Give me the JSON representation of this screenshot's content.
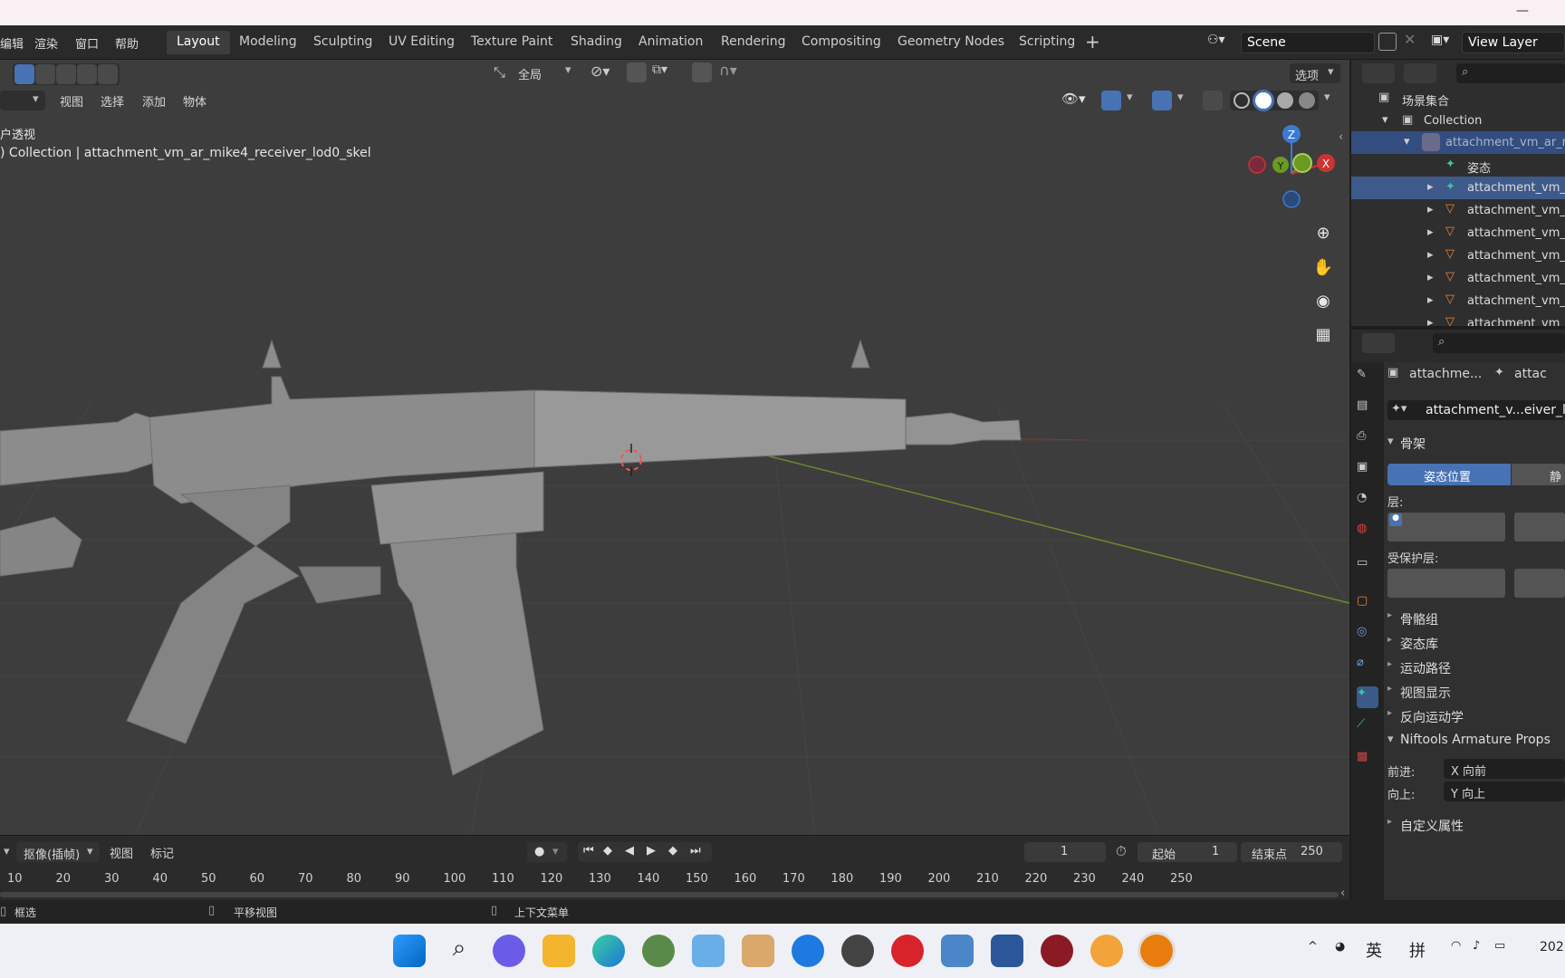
{
  "menu": {
    "edit": "编辑",
    "render": "渲染",
    "window": "窗口",
    "help": "帮助"
  },
  "workspaces": [
    "Layout",
    "Modeling",
    "Sculpting",
    "UV Editing",
    "Texture Paint",
    "Shading",
    "Animation",
    "Rendering",
    "Compositing",
    "Geometry Nodes",
    "Scripting"
  ],
  "active_workspace": "Layout",
  "scene_name": "Scene",
  "view_layer": "View Layer",
  "viewport_header": {
    "transform_orientation": "全局",
    "options": "选项",
    "menus": [
      "视图",
      "选择",
      "添加",
      "物体"
    ]
  },
  "viewport_info": {
    "mode": "户透视",
    "breadcrumb": ") Collection | attachment_vm_ar_mike4_receiver_lod0_skel"
  },
  "gizmo": {
    "z": "Z",
    "y": "Y",
    "x": "X"
  },
  "outliner": {
    "scene_collection": "场景集合",
    "collection": "Collection",
    "armature_obj": "attachment_vm_ar_r",
    "pose": "姿态",
    "items": [
      "attachment_vm_",
      "attachment_vm_",
      "attachment_vm_",
      "attachment_vm_",
      "attachment_vm_",
      "attachment_vm_",
      "attachment_vm_"
    ]
  },
  "properties": {
    "breadcrumb_1": "attachme...",
    "breadcrumb_2": "attac",
    "data_name": "attachment_v...eiver_lo",
    "skeleton_panel": "骨架",
    "pose_position": "姿态位置",
    "rest_position": "静",
    "layers_label": "层:",
    "protected_layers_label": "受保护层:",
    "panels": [
      "骨骼组",
      "姿态库",
      "运动路径",
      "视图显示",
      "反向运动学"
    ],
    "niftools_panel": "Niftools Armature Props",
    "forward_label": "前进:",
    "forward_value": "X 向前",
    "up_label": "向上:",
    "up_value": "Y 向上",
    "custom_props": "自定义属性"
  },
  "timeline": {
    "mode": "抠像(插帧)",
    "view": "视图",
    "marker": "标记",
    "current_frame": "1",
    "start_label": "起始",
    "start_value": "1",
    "end_label": "结束点",
    "end_value": "250",
    "ticks": [
      "10",
      "20",
      "30",
      "40",
      "50",
      "60",
      "70",
      "80",
      "90",
      "100",
      "110",
      "120",
      "130",
      "140",
      "150",
      "160",
      "170",
      "180",
      "190",
      "200",
      "210",
      "220",
      "230",
      "240",
      "250"
    ]
  },
  "statusbar": {
    "box_select": "框选",
    "pan_view": "平移视图",
    "context_menu": "上下文菜单"
  },
  "taskbar": {
    "ime_lang": "英",
    "ime_mode": "拼",
    "clock": "202"
  }
}
